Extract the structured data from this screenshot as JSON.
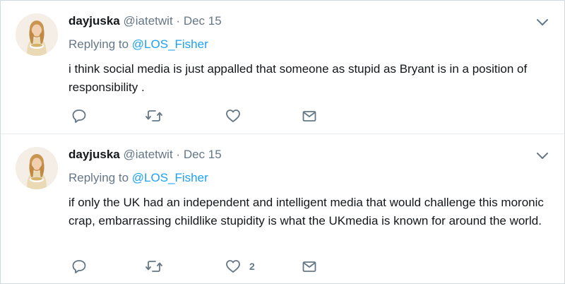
{
  "tweets": [
    {
      "author_name": "dayjuska",
      "handle": "@iatetwit",
      "separator": "·",
      "date": "Dec 15",
      "replying_prefix": "Replying to",
      "replying_to": "@LOS_Fisher",
      "text": "i think social media is just appalled that someone as stupid as Bryant is in a position of responsibility .",
      "like_count": "",
      "icons": {
        "reply": "reply-icon",
        "retweet": "retweet-icon",
        "like": "heart-icon",
        "message": "envelope-icon",
        "menu": "chevron-down-icon"
      }
    },
    {
      "author_name": "dayjuska",
      "handle": "@iatetwit",
      "separator": "·",
      "date": "Dec 15",
      "replying_prefix": "Replying to",
      "replying_to": "@LOS_Fisher",
      "text": "if only the UK had an independent and intelligent media that would challenge this moronic crap, embarrassing childlike stupidity is what the UKmedia is known for around the world.",
      "like_count": "2",
      "icons": {
        "reply": "reply-icon",
        "retweet": "retweet-icon",
        "like": "heart-icon",
        "message": "envelope-icon",
        "menu": "chevron-down-icon"
      }
    }
  ],
  "colors": {
    "text": "#14171a",
    "secondary": "#657786",
    "link": "#1da1f2",
    "border": "#e6ecf0"
  }
}
